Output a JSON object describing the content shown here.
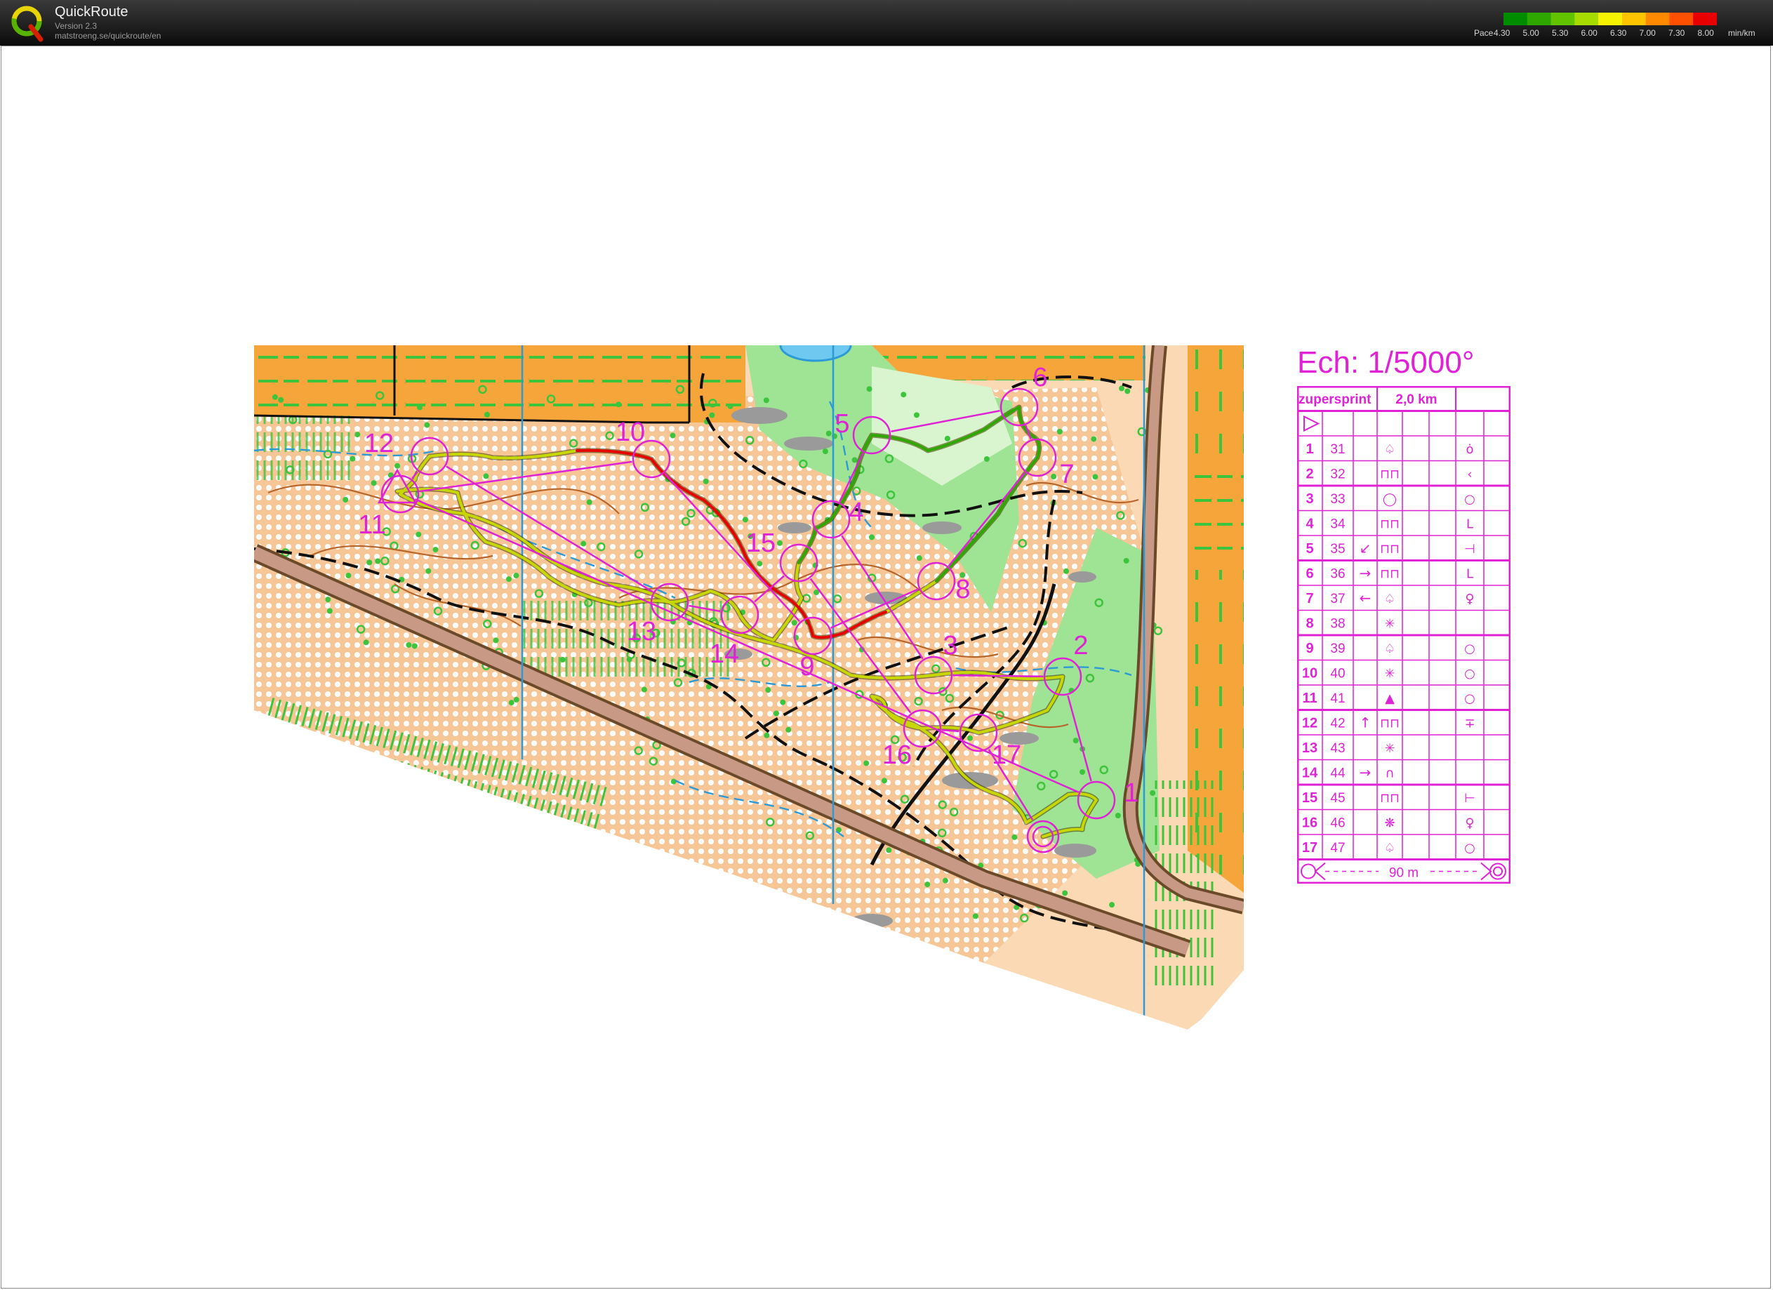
{
  "header": {
    "app_title": "QuickRoute",
    "version": "Version 2.3",
    "url": "matstroeng.se/quickroute/en",
    "legend": {
      "pace_label": "Pace",
      "unit": "min/km",
      "ticks": [
        "4.30",
        "5.00",
        "5.30",
        "6.00",
        "6.30",
        "7.00",
        "7.30",
        "8.00"
      ],
      "colors": [
        "#008c00",
        "#2ea800",
        "#62c400",
        "#a7dc00",
        "#f6f300",
        "#ffc400",
        "#ff8a00",
        "#ff4f00",
        "#e80000"
      ]
    }
  },
  "map": {
    "scale_title": "Ech: 1/5000°",
    "course_color": "#e022d6",
    "control_labels": [
      "1",
      "2",
      "3",
      "4",
      "5",
      "6",
      "7",
      "8",
      "9",
      "10",
      "11",
      "12",
      "13",
      "14",
      "15",
      "16",
      "17"
    ]
  },
  "control_description": {
    "course_name": "zupersprint",
    "length": "2,0 km",
    "rows": [
      {
        "num": "1",
        "code": "31"
      },
      {
        "num": "2",
        "code": "32"
      },
      {
        "num": "3",
        "code": "33"
      },
      {
        "num": "4",
        "code": "34"
      },
      {
        "num": "5",
        "code": "35"
      },
      {
        "num": "6",
        "code": "36"
      },
      {
        "num": "7",
        "code": "37"
      },
      {
        "num": "8",
        "code": "38"
      },
      {
        "num": "9",
        "code": "39"
      },
      {
        "num": "10",
        "code": "40"
      },
      {
        "num": "11",
        "code": "41"
      },
      {
        "num": "12",
        "code": "42"
      },
      {
        "num": "13",
        "code": "43"
      },
      {
        "num": "14",
        "code": "44"
      },
      {
        "num": "15",
        "code": "45"
      },
      {
        "num": "16",
        "code": "46"
      },
      {
        "num": "17",
        "code": "47"
      }
    ],
    "finish_distance": "90 m"
  }
}
